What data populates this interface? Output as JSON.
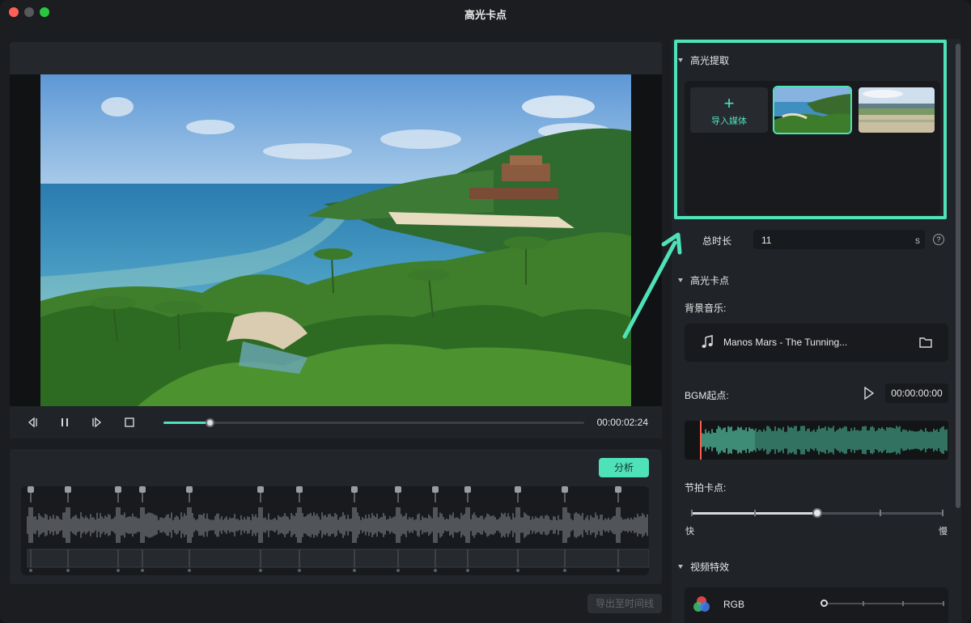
{
  "window": {
    "title": "高光卡点"
  },
  "player": {
    "timecode": "00:00:02:24",
    "progress": 0.11
  },
  "analysis": {
    "analyze_label": "分析",
    "export_label": "导出至时间线"
  },
  "highlight_extract": {
    "section_title": "高光提取",
    "import_label": "导入媒体",
    "plus_glyph": "+",
    "thumbnails": [
      {
        "name": "beach-coast",
        "selected": true
      },
      {
        "name": "flat-shore",
        "selected": false
      }
    ]
  },
  "duration": {
    "label": "总时长",
    "value": "11",
    "unit": "s",
    "help_glyph": "?"
  },
  "highlight_beat": {
    "section_title": "高光卡点",
    "bgm_label": "背景音乐:",
    "bgm_track": "Manos Mars - The Tunning...",
    "bgm_start_label": "BGM起点:",
    "bgm_start_value": "00:00:00:00",
    "beat_label": "节拍卡点:",
    "beat_level": 0.5,
    "fast_label": "快",
    "slow_label": "慢"
  },
  "video_effects": {
    "section_title": "视频特效",
    "rgb_label": "RGB",
    "rgb_level": 0
  },
  "colors": {
    "accent": "#4fe1b8",
    "playhead": "#ff5a4e",
    "close": "#ff5f57",
    "maximize": "#28c840"
  }
}
